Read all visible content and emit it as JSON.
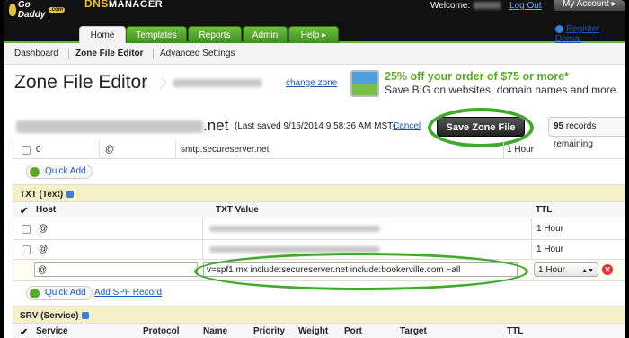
{
  "header": {
    "logo_text": "Go Daddy",
    "logo_suffix": ".com",
    "brand_prefix": "DNS",
    "brand_suffix": "MANAGER",
    "welcome_label": "Welcome:",
    "logout_label": "Log Out",
    "my_account_label": "My Account"
  },
  "nav": {
    "tabs": [
      "Home",
      "Templates",
      "Reports",
      "Admin",
      "Help"
    ],
    "active_tab": "Home",
    "register_label": "Register Domai"
  },
  "subnav": {
    "items": [
      "Dashboard",
      "Zone File Editor",
      "Advanced Settings"
    ]
  },
  "page": {
    "title": "Zone File Editor",
    "change_zone_label": "change zone",
    "promo_line1": "25% off your order of $75 or more*",
    "promo_line2": "Save BIG on websites, domain names and more.",
    "domain_tld": ".net",
    "last_saved": "(Last saved 9/15/2014 9:58:36 AM MST)",
    "cancel_label": "Cancel",
    "save_label": "Save Zone File",
    "records_count": "95",
    "records_label": "records remaining"
  },
  "mx_row": {
    "priority": "0",
    "host": "@",
    "points_to": "smtp.secureserver.net",
    "ttl": "1 Hour"
  },
  "quick_add_label": "Quick Add",
  "txt_section": {
    "title": "TXT (Text)",
    "columns": [
      "Host",
      "TXT Value",
      "TTL"
    ],
    "rows": [
      {
        "host": "@",
        "ttl": "1 Hour"
      },
      {
        "host": "@",
        "ttl": "1 Hour"
      }
    ],
    "edit_row": {
      "host": "@",
      "value": "v=spf1 mx include:secureserver.net include:bookerville.com ~all",
      "ttl": "1 Hour"
    },
    "add_spf_label": "Add SPF Record"
  },
  "srv_section": {
    "title": "SRV (Service)",
    "columns": [
      "Service",
      "Protocol",
      "Name",
      "Priority",
      "Weight",
      "Port",
      "Target",
      "TTL"
    ]
  },
  "colors": {
    "nav_green": "#4fa52a",
    "highlight_ring": "#3faa2c",
    "link": "#1a55c4",
    "promo_green": "#5aaa2a",
    "section_bg": "#f5f0c8"
  }
}
